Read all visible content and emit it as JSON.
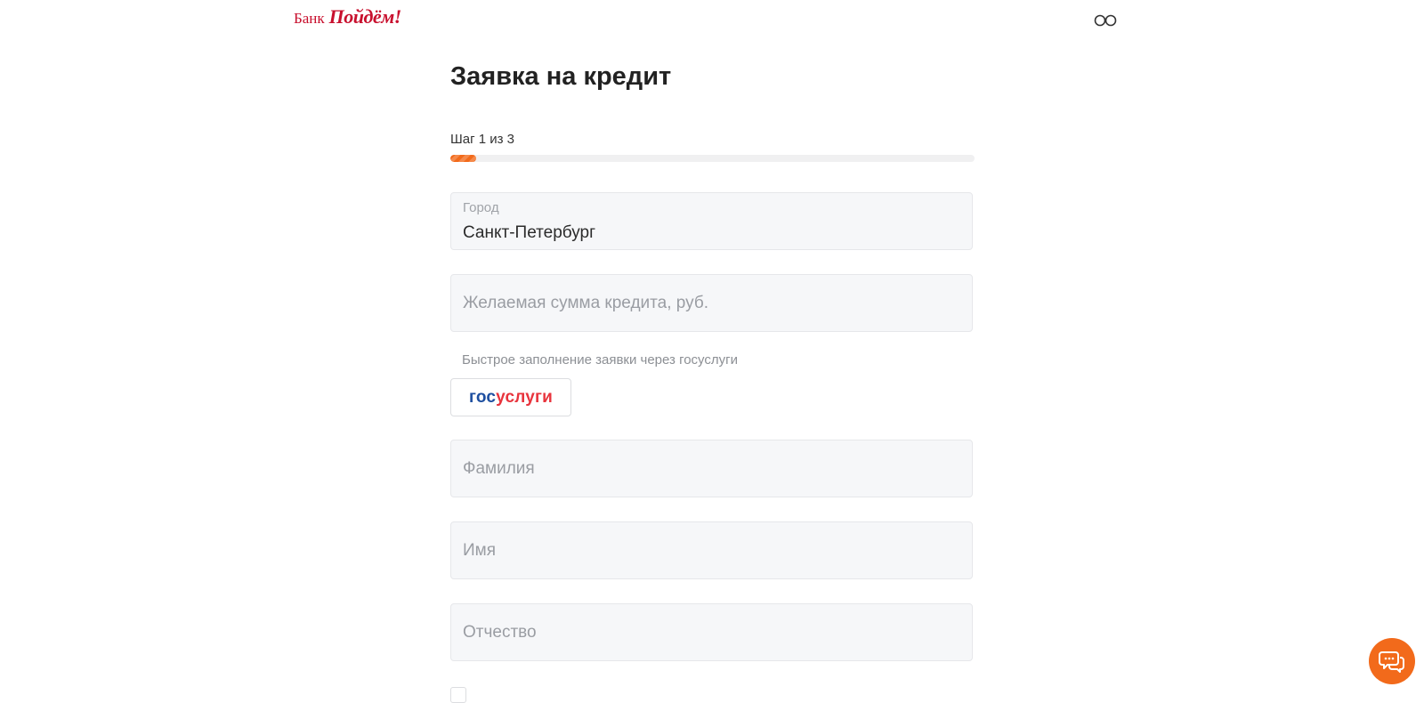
{
  "header": {
    "logo_bank": "Банк",
    "logo_brand": "Пойдём!",
    "accessibility_icon": "glasses-icon"
  },
  "form": {
    "title": "Заявка на кредит",
    "step_text": "Шаг 1 из 3",
    "progress": {
      "current_step": 1,
      "total_steps": 3,
      "fill_fraction": 0.05
    },
    "city": {
      "label": "Город",
      "value": "Санкт-Петербург"
    },
    "amount": {
      "placeholder": "Желаемая сумма кредита, руб."
    },
    "gosuslugi": {
      "hint": "Быстрое заполнение заявки через госуслуги",
      "button_part1": "гос",
      "button_part2": "услуги"
    },
    "last_name": {
      "placeholder": "Фамилия"
    },
    "first_name": {
      "placeholder": "Имя"
    },
    "patronymic": {
      "placeholder": "Отчество"
    }
  },
  "chat": {
    "icon": "chat-bubbles-icon"
  },
  "colors": {
    "accent": "#f26a1b",
    "brand_red": "#c8102e",
    "gosuslugi_blue": "#1e4fa0",
    "gosuslugi_red": "#e8343d"
  }
}
